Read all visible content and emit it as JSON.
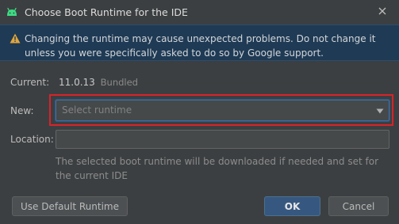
{
  "window": {
    "title": "Choose Boot Runtime for the IDE",
    "app_icon": "android-icon",
    "close_icon": "close-icon"
  },
  "warning": {
    "icon": "warning-icon",
    "text": "Changing the runtime may cause unexpected problems. Do not change it unless you were specifically asked to do so by Google support.",
    "background": "#1f3a54",
    "icon_color": "#e2a63b"
  },
  "current": {
    "label": "Current:",
    "version": "11.0.13",
    "tag": "Bundled"
  },
  "new_runtime": {
    "label": "New:",
    "placeholder": "Select runtime",
    "highlight_color": "#d8232a"
  },
  "location": {
    "label": "Location:",
    "value": "",
    "hint": "The selected boot runtime will be downloaded if needed and set for the current IDE"
  },
  "buttons": {
    "use_default": "Use Default Runtime",
    "ok": "OK",
    "cancel": "Cancel"
  },
  "colors": {
    "background": "#3c3f41",
    "accent": "#365880"
  }
}
